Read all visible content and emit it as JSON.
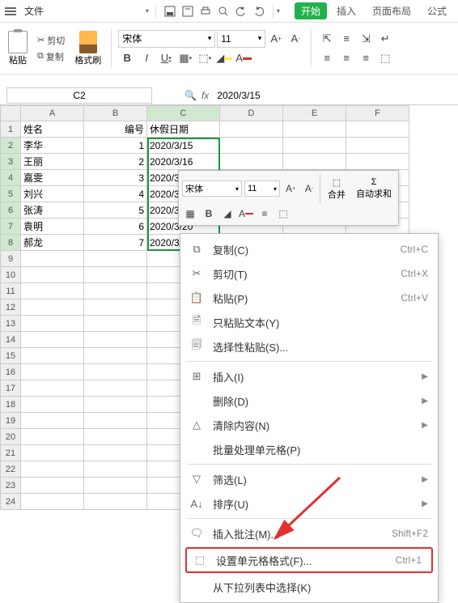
{
  "menubar": {
    "file_label": "文件",
    "tabs": {
      "start": "开始",
      "insert": "插入",
      "page_layout": "页面布局",
      "formula": "公式"
    }
  },
  "ribbon": {
    "paste_label": "粘贴",
    "cut_label": "剪切",
    "copy_label": "复制",
    "format_painter_label": "格式刷",
    "font_name": "宋体",
    "font_size": "11"
  },
  "formula_bar": {
    "name_box": "C2",
    "formula": "2020/3/15"
  },
  "columns": [
    "A",
    "B",
    "C",
    "D",
    "E",
    "F"
  ],
  "col_widths": {
    "A": 78,
    "B": 78,
    "C": 90,
    "D": 78,
    "E": 78,
    "F": 78
  },
  "headers": {
    "A": "姓名",
    "B": "编号",
    "C": "休假日期"
  },
  "rows": [
    {
      "n": 1,
      "A": "姓名",
      "B": "编号",
      "C": "休假日期"
    },
    {
      "n": 2,
      "A": "李华",
      "B": "1",
      "C": "2020/3/15"
    },
    {
      "n": 3,
      "A": "王丽",
      "B": "2",
      "C": "2020/3/16"
    },
    {
      "n": 4,
      "A": "嘉雯",
      "B": "3",
      "C": "2020/3/17"
    },
    {
      "n": 5,
      "A": "刘兴",
      "B": "4",
      "C": "2020/3/18"
    },
    {
      "n": 6,
      "A": "张涛",
      "B": "5",
      "C": "2020/3/19"
    },
    {
      "n": 7,
      "A": "袁明",
      "B": "6",
      "C": "2020/3/20"
    },
    {
      "n": 8,
      "A": "郝龙",
      "B": "7",
      "C": "2020/3/21"
    }
  ],
  "empty_rows": [
    9,
    10,
    11,
    12,
    13,
    14,
    15,
    16,
    17,
    18,
    19,
    20,
    21,
    22,
    23,
    24
  ],
  "mini_toolbar": {
    "font_name": "宋体",
    "font_size": "11",
    "merge_label": "合并",
    "autosum_label": "自动求和"
  },
  "context_menu": {
    "items": [
      {
        "icon": "copy",
        "label": "复制(C)",
        "shortcut": "Ctrl+C"
      },
      {
        "icon": "cut",
        "label": "剪切(T)",
        "shortcut": "Ctrl+X"
      },
      {
        "icon": "paste",
        "label": "粘贴(P)",
        "shortcut": "Ctrl+V"
      },
      {
        "icon": "paste-text",
        "label": "只粘贴文本(Y)",
        "shortcut": ""
      },
      {
        "icon": "paste-special",
        "label": "选择性粘贴(S)...",
        "shortcut": ""
      },
      {
        "sep": true
      },
      {
        "icon": "insert",
        "label": "插入(I)",
        "shortcut": "",
        "arrow": true
      },
      {
        "icon": "",
        "label": "删除(D)",
        "shortcut": "",
        "arrow": true
      },
      {
        "icon": "clear",
        "label": "清除内容(N)",
        "shortcut": "",
        "arrow": true
      },
      {
        "icon": "",
        "label": "批量处理单元格(P)",
        "shortcut": ""
      },
      {
        "sep": true
      },
      {
        "icon": "filter",
        "label": "筛选(L)",
        "shortcut": "",
        "arrow": true
      },
      {
        "icon": "sort",
        "label": "排序(U)",
        "shortcut": "",
        "arrow": true
      },
      {
        "sep": true
      },
      {
        "icon": "comment",
        "label": "插入批注(M)...",
        "shortcut": "Shift+F2"
      },
      {
        "icon": "format",
        "label": "设置单元格格式(F)...",
        "shortcut": "Ctrl+1",
        "highlighted": true
      },
      {
        "icon": "",
        "label": "从下拉列表中选择(K)",
        "shortcut": ""
      }
    ]
  }
}
